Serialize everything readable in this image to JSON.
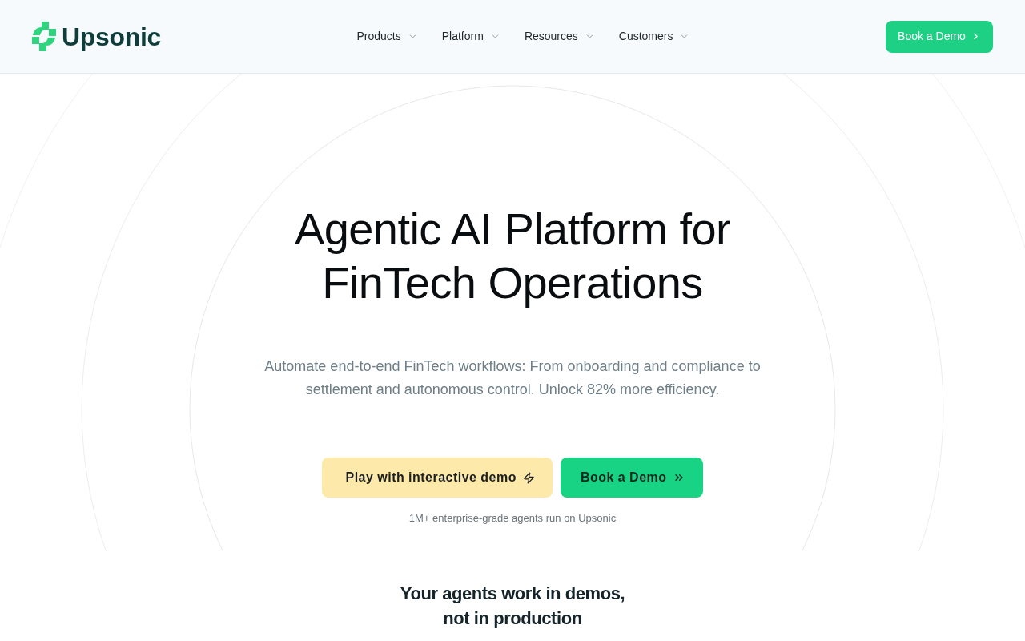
{
  "header": {
    "logo": "Upsonic",
    "nav": [
      {
        "label": "Products"
      },
      {
        "label": "Platform"
      },
      {
        "label": "Resources"
      },
      {
        "label": "Customers"
      }
    ],
    "cta": "Book a Demo"
  },
  "hero": {
    "title": "Agentic AI Platform for FinTech Operations",
    "subtitle": "Automate end-to-end FinTech workflows: From onboarding and compliance to settlement and autonomous control. Unlock 82% more efficiency.",
    "buttons": [
      {
        "label": "Play with interactive demo",
        "kind": "secondary"
      },
      {
        "label": "Book a Demo",
        "kind": "primary"
      }
    ],
    "caption": "1M+ enterprise-grade agents run on Upsonic"
  },
  "section": {
    "heading": "Your agents work in demos, not in production"
  }
}
